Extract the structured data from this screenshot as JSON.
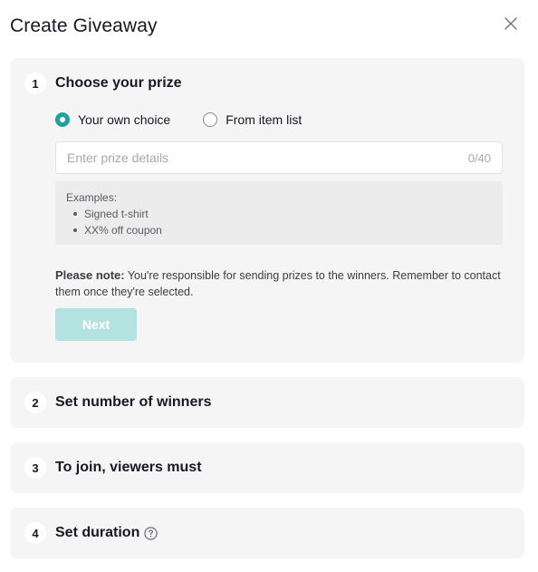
{
  "dialog": {
    "title": "Create Giveaway"
  },
  "steps": [
    {
      "number": "1",
      "title": "Choose your prize",
      "radios": [
        {
          "label": "Your own choice",
          "selected": true
        },
        {
          "label": "From item list",
          "selected": false
        }
      ],
      "input": {
        "placeholder": "Enter prize details",
        "value": "",
        "counter": "0/40"
      },
      "examples": {
        "heading": "Examples:",
        "items": [
          "Signed t-shirt",
          "XX% off coupon"
        ]
      },
      "note": {
        "bold": "Please note:",
        "text": " You're responsible for sending prizes to the winners. Remember to contact them once they're selected."
      },
      "next_label": "Next"
    },
    {
      "number": "2",
      "title": "Set number of winners"
    },
    {
      "number": "3",
      "title": "To join, viewers must"
    },
    {
      "number": "4",
      "title": "Set duration",
      "icon": "help-circle-icon"
    }
  ],
  "colors": {
    "accent": "#21a0a0",
    "button_disabled": "#b3e3e0",
    "card_bg": "#f5f5f6"
  }
}
